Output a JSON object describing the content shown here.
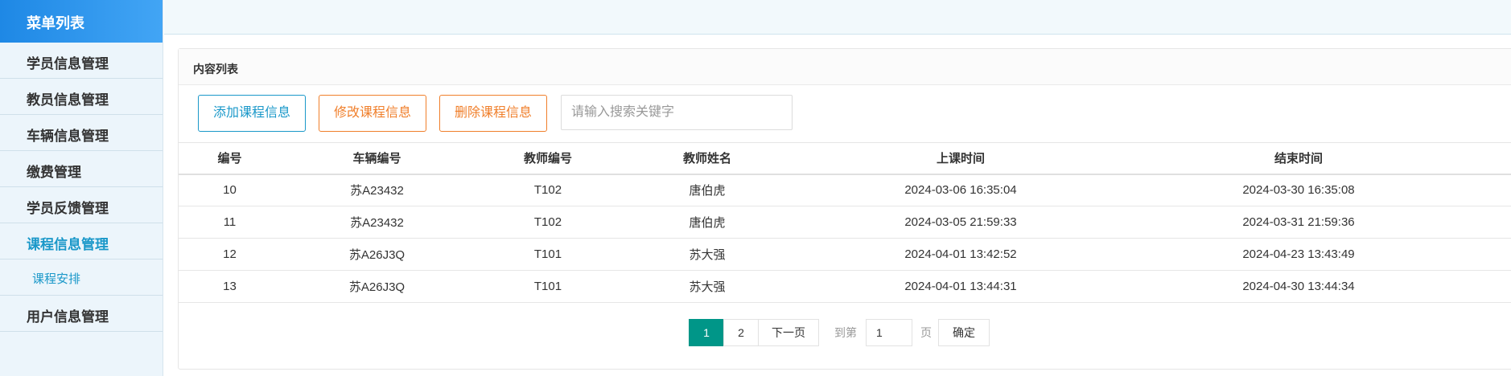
{
  "sidebar": {
    "title": "菜单列表",
    "items": [
      {
        "label": "学员信息管理"
      },
      {
        "label": "教员信息管理"
      },
      {
        "label": "车辆信息管理"
      },
      {
        "label": "缴费管理"
      },
      {
        "label": "学员反馈管理"
      },
      {
        "label": "课程信息管理"
      }
    ],
    "sub_item": "课程安排",
    "last_item": "用户信息管理"
  },
  "panel": {
    "title": "内容列表",
    "add_button": "添加课程信息",
    "edit_button": "修改课程信息",
    "delete_button": "删除课程信息",
    "search_placeholder": "请输入搜索关键字"
  },
  "table": {
    "headers": [
      "编号",
      "车辆编号",
      "教师编号",
      "教师姓名",
      "上课时间",
      "结束时间"
    ],
    "rows": [
      [
        "10",
        "苏A23432",
        "T102",
        "唐伯虎",
        "2024-03-06 16:35:04",
        "2024-03-30 16:35:08"
      ],
      [
        "11",
        "苏A23432",
        "T102",
        "唐伯虎",
        "2024-03-05 21:59:33",
        "2024-03-31 21:59:36"
      ],
      [
        "12",
        "苏A26J3Q",
        "T101",
        "苏大强",
        "2024-04-01 13:42:52",
        "2024-04-23 13:43:49"
      ],
      [
        "13",
        "苏A26J3Q",
        "T101",
        "苏大强",
        "2024-04-01 13:44:31",
        "2024-04-30 13:44:34"
      ]
    ]
  },
  "pagination": {
    "page1": "1",
    "page2": "2",
    "next": "下一页",
    "goto_label": "到第",
    "goto_value": "1",
    "page_unit": "页",
    "confirm": "确定"
  },
  "colors": {
    "accent": "#1a98c9",
    "warning": "#f07f2b",
    "current_page": "#009688"
  }
}
